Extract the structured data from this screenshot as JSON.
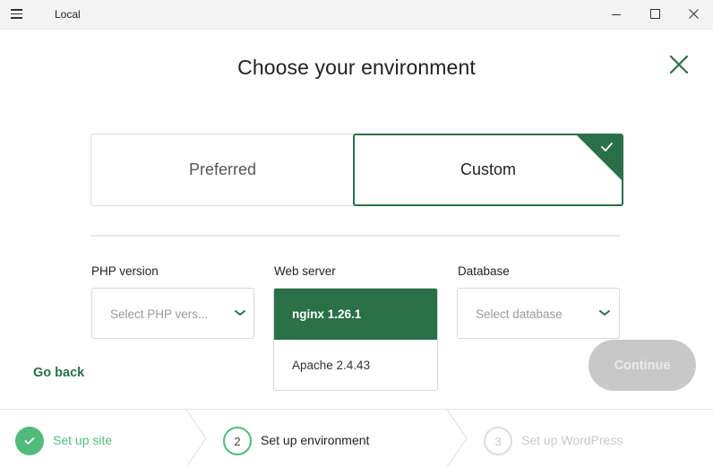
{
  "window": {
    "title": "Local"
  },
  "page": {
    "title": "Choose your environment"
  },
  "environment_options": [
    {
      "label": "Preferred",
      "selected": false
    },
    {
      "label": "Custom",
      "selected": true
    }
  ],
  "fields": {
    "php": {
      "label": "PHP version",
      "placeholder": "Select PHP vers..."
    },
    "web_server": {
      "label": "Web server",
      "options": [
        {
          "label": "nginx 1.26.1",
          "selected": true
        },
        {
          "label": "Apache 2.4.43",
          "selected": false
        }
      ]
    },
    "database": {
      "label": "Database",
      "placeholder": "Select database"
    }
  },
  "actions": {
    "go_back": "Go back",
    "continue": "Continue"
  },
  "steps": [
    {
      "number": "1",
      "label": "Set up site",
      "status": "completed"
    },
    {
      "number": "2",
      "label": "Set up environment",
      "status": "current"
    },
    {
      "number": "3",
      "label": "Set up WordPress",
      "status": "upcoming"
    }
  ],
  "colors": {
    "accent": "#2a7048",
    "step_green": "#51bb7b",
    "disabled_button": "#c8c8c8"
  }
}
